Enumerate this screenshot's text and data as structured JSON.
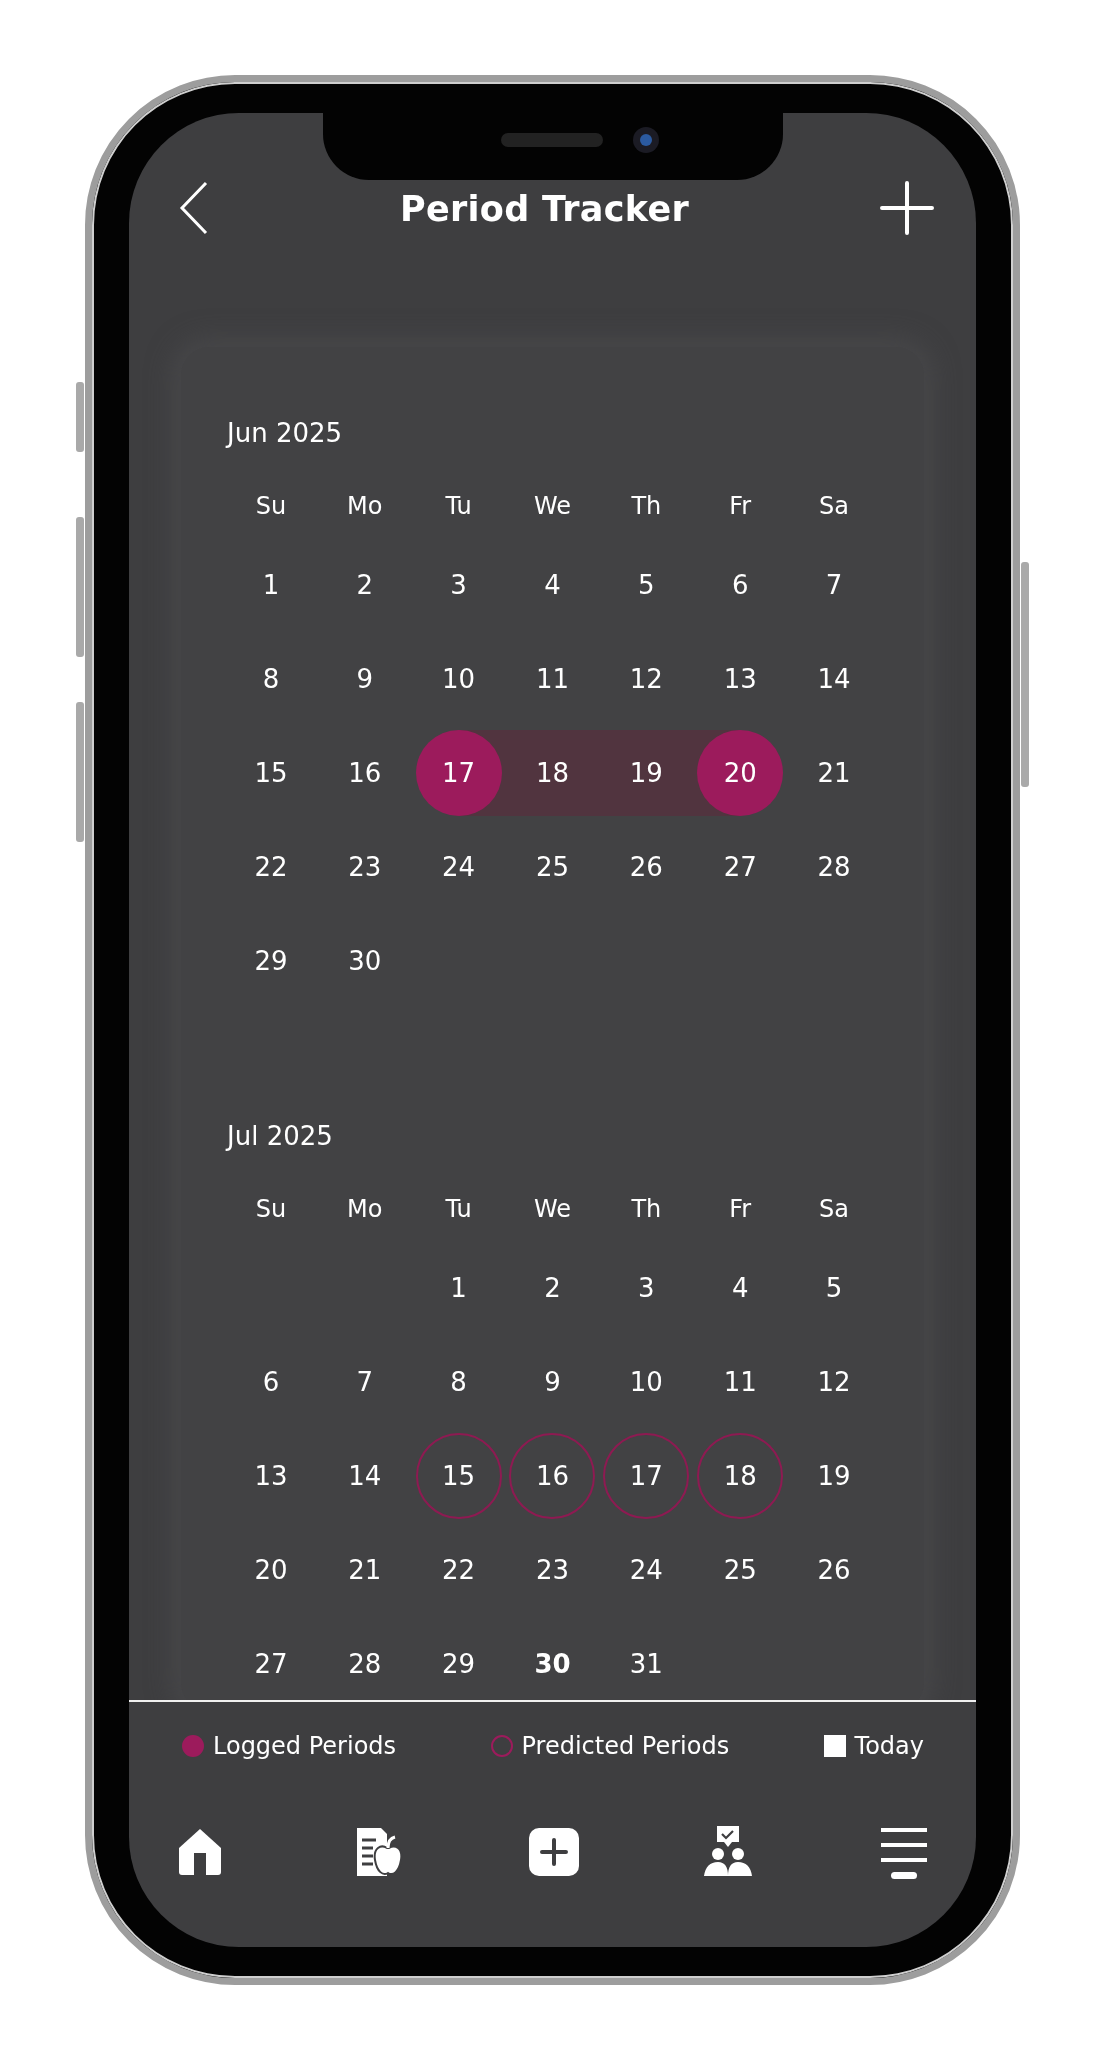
{
  "header": {
    "title": "Period Tracker"
  },
  "months": [
    {
      "label": "Jun 2025",
      "weekdays": [
        "Su",
        "Mo",
        "Tu",
        "We",
        "Th",
        "Fr",
        "Sa"
      ],
      "weeks": [
        [
          {
            "day": "1",
            "kind": "plain"
          },
          {
            "day": "2",
            "kind": "plain"
          },
          {
            "day": "3",
            "kind": "plain"
          },
          {
            "day": "4",
            "kind": "plain"
          },
          {
            "day": "5",
            "kind": "plain"
          },
          {
            "day": "6",
            "kind": "plain"
          },
          {
            "day": "7",
            "kind": "plain"
          }
        ],
        [
          {
            "day": "8",
            "kind": "plain"
          },
          {
            "day": "9",
            "kind": "plain"
          },
          {
            "day": "10",
            "kind": "plain"
          },
          {
            "day": "11",
            "kind": "plain"
          },
          {
            "day": "12",
            "kind": "plain"
          },
          {
            "day": "13",
            "kind": "plain"
          },
          {
            "day": "14",
            "kind": "plain"
          }
        ],
        [
          {
            "day": "15",
            "kind": "plain"
          },
          {
            "day": "16",
            "kind": "plain"
          },
          {
            "day": "17",
            "kind": "logged-start"
          },
          {
            "day": "18",
            "kind": "logged-mid"
          },
          {
            "day": "19",
            "kind": "logged-mid"
          },
          {
            "day": "20",
            "kind": "logged-end"
          },
          {
            "day": "21",
            "kind": "plain"
          }
        ],
        [
          {
            "day": "22",
            "kind": "plain"
          },
          {
            "day": "23",
            "kind": "plain"
          },
          {
            "day": "24",
            "kind": "plain"
          },
          {
            "day": "25",
            "kind": "plain"
          },
          {
            "day": "26",
            "kind": "plain"
          },
          {
            "day": "27",
            "kind": "plain"
          },
          {
            "day": "28",
            "kind": "plain"
          }
        ],
        [
          {
            "day": "29",
            "kind": "plain"
          },
          {
            "day": "30",
            "kind": "plain"
          },
          {
            "kind": "blank"
          },
          {
            "kind": "blank"
          },
          {
            "kind": "blank"
          },
          {
            "kind": "blank"
          },
          {
            "kind": "blank"
          }
        ]
      ]
    },
    {
      "label": "Jul 2025",
      "weekdays": [
        "Su",
        "Mo",
        "Tu",
        "We",
        "Th",
        "Fr",
        "Sa"
      ],
      "weeks": [
        [
          {
            "kind": "blank"
          },
          {
            "kind": "blank"
          },
          {
            "day": "1",
            "kind": "plain"
          },
          {
            "day": "2",
            "kind": "plain"
          },
          {
            "day": "3",
            "kind": "plain"
          },
          {
            "day": "4",
            "kind": "plain"
          },
          {
            "day": "5",
            "kind": "plain"
          }
        ],
        [
          {
            "day": "6",
            "kind": "plain"
          },
          {
            "day": "7",
            "kind": "plain"
          },
          {
            "day": "8",
            "kind": "plain"
          },
          {
            "day": "9",
            "kind": "plain"
          },
          {
            "day": "10",
            "kind": "plain"
          },
          {
            "day": "11",
            "kind": "plain"
          },
          {
            "day": "12",
            "kind": "plain"
          }
        ],
        [
          {
            "day": "13",
            "kind": "plain"
          },
          {
            "day": "14",
            "kind": "plain"
          },
          {
            "day": "15",
            "kind": "predicted"
          },
          {
            "day": "16",
            "kind": "predicted"
          },
          {
            "day": "17",
            "kind": "predicted"
          },
          {
            "day": "18",
            "kind": "predicted"
          },
          {
            "day": "19",
            "kind": "plain"
          }
        ],
        [
          {
            "day": "20",
            "kind": "plain"
          },
          {
            "day": "21",
            "kind": "plain"
          },
          {
            "day": "22",
            "kind": "plain"
          },
          {
            "day": "23",
            "kind": "plain"
          },
          {
            "day": "24",
            "kind": "plain"
          },
          {
            "day": "25",
            "kind": "plain"
          },
          {
            "day": "26",
            "kind": "plain"
          }
        ],
        [
          {
            "day": "27",
            "kind": "plain"
          },
          {
            "day": "28",
            "kind": "plain"
          },
          {
            "day": "29",
            "kind": "plain"
          },
          {
            "day": "30",
            "kind": "today"
          },
          {
            "day": "31",
            "kind": "plain"
          },
          {
            "kind": "blank"
          },
          {
            "kind": "blank"
          }
        ]
      ]
    }
  ],
  "legend": [
    {
      "label": "Logged Periods",
      "kind": "filled-dot",
      "color": "#9c1b5c"
    },
    {
      "label": "Predicted Periods",
      "kind": "outline-dot",
      "color": "#9c1b5c"
    },
    {
      "label": "Today",
      "kind": "square",
      "color": "#ffffff"
    }
  ],
  "nav": [
    {
      "kind": "home",
      "selected": false
    },
    {
      "kind": "diet",
      "selected": false
    },
    {
      "kind": "add",
      "selected": false
    },
    {
      "kind": "consult",
      "selected": false
    },
    {
      "kind": "menu",
      "selected": true
    }
  ]
}
